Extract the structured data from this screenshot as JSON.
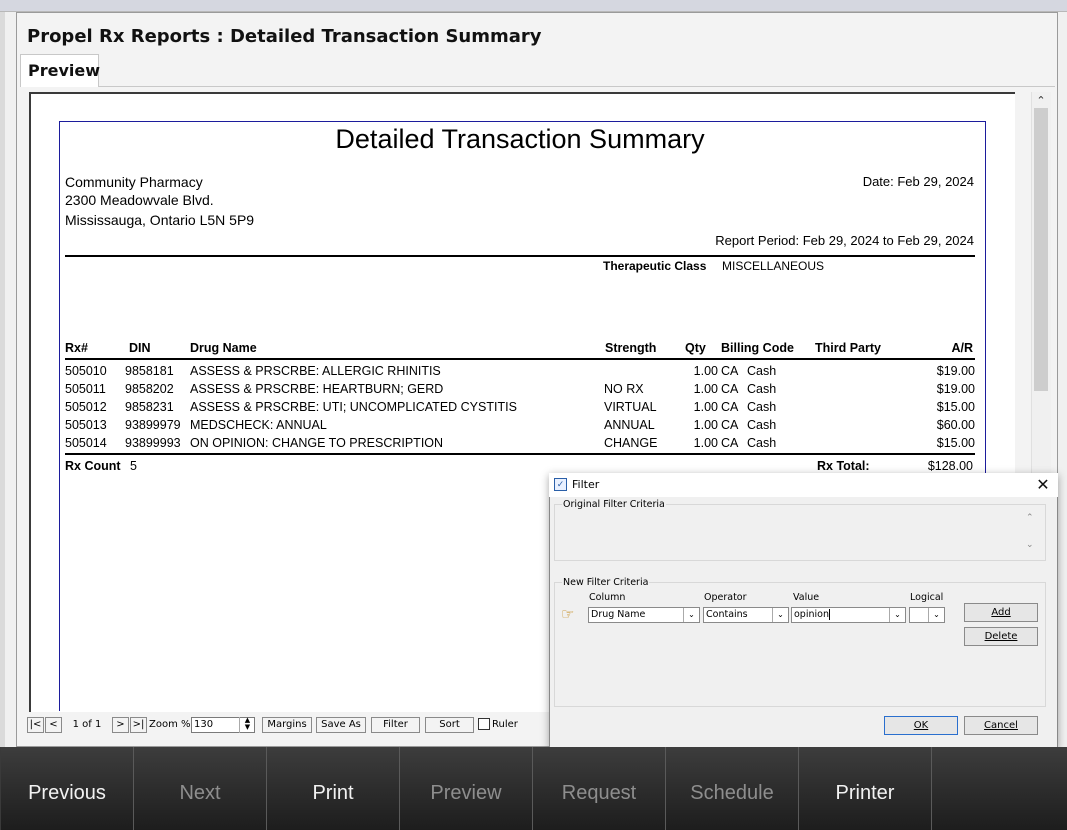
{
  "app_title": "Propel Rx Reports : Detailed Transaction Summary",
  "tab_label": "Preview",
  "report": {
    "title": "Detailed Transaction Summary",
    "pharmacy_name": "Community Pharmacy",
    "address_line1": "2300 Meadowvale Blvd.",
    "address_line2": "Mississauga, Ontario L5N 5P9",
    "date": "Date: Feb 29, 2024",
    "report_period": "Report Period: Feb 29, 2024 to Feb 29, 2024",
    "therapeutic_class_label": "Therapeutic Class",
    "therapeutic_class_value": "MISCELLANEOUS",
    "columns": {
      "rx": "Rx#",
      "din": "DIN",
      "drug_name": "Drug Name",
      "strength": "Strength",
      "qty": "Qty",
      "billing_code": "Billing Code",
      "third_party": "Third Party",
      "ar": "A/R"
    },
    "rows": [
      {
        "rx": "505010",
        "din": "9858181",
        "drug": "ASSESS & PRSCRBE: ALLERGIC RHINITIS",
        "strength": "",
        "qty": "1.00",
        "code": "CA",
        "payer": "Cash",
        "ar": "$19.00"
      },
      {
        "rx": "505011",
        "din": "9858202",
        "drug": "ASSESS & PRSCRBE: HEARTBURN; GERD",
        "strength": "NO RX",
        "qty": "1.00",
        "code": "CA",
        "payer": "Cash",
        "ar": "$19.00"
      },
      {
        "rx": "505012",
        "din": "9858231",
        "drug": "ASSESS & PRSCRBE: UTI; UNCOMPLICATED CYSTITIS",
        "strength": "VIRTUAL",
        "qty": "1.00",
        "code": "CA",
        "payer": "Cash",
        "ar": "$15.00"
      },
      {
        "rx": "505013",
        "din": "93899979",
        "drug": "MEDSCHECK: ANNUAL",
        "strength": "ANNUAL",
        "qty": "1.00",
        "code": "CA",
        "payer": "Cash",
        "ar": "$60.00"
      },
      {
        "rx": "505014",
        "din": "93899993",
        "drug": "ON OPINION: CHANGE TO PRESCRIPTION",
        "strength": "CHANGE",
        "qty": "1.00",
        "code": "CA",
        "payer": "Cash",
        "ar": "$15.00"
      }
    ],
    "rx_count_label": "Rx Count",
    "rx_count_value": "5",
    "rx_total_label": "Rx Total:",
    "rx_total_value": "$128.00"
  },
  "toolbar": {
    "first": "|<",
    "prev": "<",
    "page_indicator": "1 of 1",
    "next": ">",
    "last": ">|",
    "zoom_label": "Zoom %:",
    "zoom_value": "130",
    "margins": "Margins",
    "save_as": "Save As",
    "filter": "Filter",
    "sort": "Sort",
    "ruler": "Ruler"
  },
  "filter_dialog": {
    "title": "Filter",
    "original_group": "Original Filter Criteria",
    "new_group": "New Filter Criteria",
    "col_column": "Column",
    "col_operator": "Operator",
    "col_value": "Value",
    "col_logical": "Logical",
    "column_value": "Drug Name",
    "operator_value": "Contains",
    "value_value": "opinion",
    "logical_value": "",
    "add": "Add",
    "delete": "Delete",
    "ok": "OK",
    "cancel": "Cancel"
  },
  "nav": [
    {
      "label": "Previous",
      "enabled": true
    },
    {
      "label": "Next",
      "enabled": false
    },
    {
      "label": "Print",
      "enabled": true
    },
    {
      "label": "Preview",
      "enabled": false
    },
    {
      "label": "Request",
      "enabled": false
    },
    {
      "label": "Schedule",
      "enabled": false
    },
    {
      "label": "Printer",
      "enabled": true
    }
  ]
}
